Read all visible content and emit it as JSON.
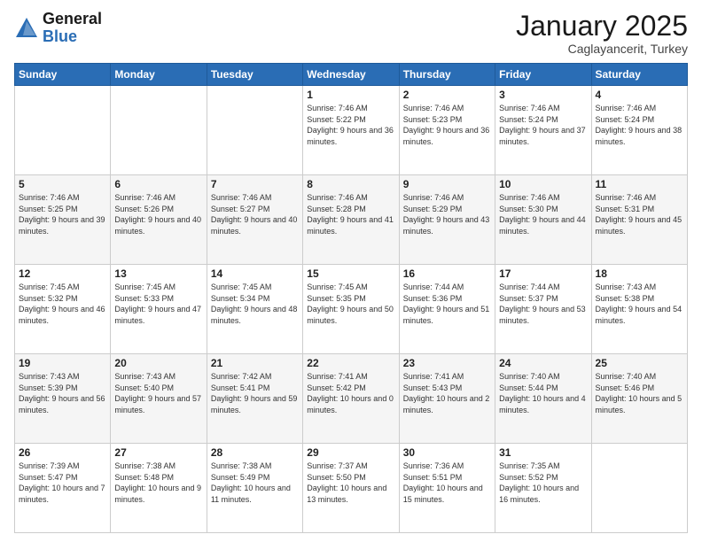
{
  "logo": {
    "general": "General",
    "blue": "Blue"
  },
  "header": {
    "month": "January 2025",
    "location": "Caglayancerit, Turkey"
  },
  "weekdays": [
    "Sunday",
    "Monday",
    "Tuesday",
    "Wednesday",
    "Thursday",
    "Friday",
    "Saturday"
  ],
  "weeks": [
    [
      null,
      null,
      null,
      {
        "day": "1",
        "sunrise": "Sunrise: 7:46 AM",
        "sunset": "Sunset: 5:22 PM",
        "daylight": "Daylight: 9 hours and 36 minutes."
      },
      {
        "day": "2",
        "sunrise": "Sunrise: 7:46 AM",
        "sunset": "Sunset: 5:23 PM",
        "daylight": "Daylight: 9 hours and 36 minutes."
      },
      {
        "day": "3",
        "sunrise": "Sunrise: 7:46 AM",
        "sunset": "Sunset: 5:24 PM",
        "daylight": "Daylight: 9 hours and 37 minutes."
      },
      {
        "day": "4",
        "sunrise": "Sunrise: 7:46 AM",
        "sunset": "Sunset: 5:24 PM",
        "daylight": "Daylight: 9 hours and 38 minutes."
      }
    ],
    [
      {
        "day": "5",
        "sunrise": "Sunrise: 7:46 AM",
        "sunset": "Sunset: 5:25 PM",
        "daylight": "Daylight: 9 hours and 39 minutes."
      },
      {
        "day": "6",
        "sunrise": "Sunrise: 7:46 AM",
        "sunset": "Sunset: 5:26 PM",
        "daylight": "Daylight: 9 hours and 40 minutes."
      },
      {
        "day": "7",
        "sunrise": "Sunrise: 7:46 AM",
        "sunset": "Sunset: 5:27 PM",
        "daylight": "Daylight: 9 hours and 40 minutes."
      },
      {
        "day": "8",
        "sunrise": "Sunrise: 7:46 AM",
        "sunset": "Sunset: 5:28 PM",
        "daylight": "Daylight: 9 hours and 41 minutes."
      },
      {
        "day": "9",
        "sunrise": "Sunrise: 7:46 AM",
        "sunset": "Sunset: 5:29 PM",
        "daylight": "Daylight: 9 hours and 43 minutes."
      },
      {
        "day": "10",
        "sunrise": "Sunrise: 7:46 AM",
        "sunset": "Sunset: 5:30 PM",
        "daylight": "Daylight: 9 hours and 44 minutes."
      },
      {
        "day": "11",
        "sunrise": "Sunrise: 7:46 AM",
        "sunset": "Sunset: 5:31 PM",
        "daylight": "Daylight: 9 hours and 45 minutes."
      }
    ],
    [
      {
        "day": "12",
        "sunrise": "Sunrise: 7:45 AM",
        "sunset": "Sunset: 5:32 PM",
        "daylight": "Daylight: 9 hours and 46 minutes."
      },
      {
        "day": "13",
        "sunrise": "Sunrise: 7:45 AM",
        "sunset": "Sunset: 5:33 PM",
        "daylight": "Daylight: 9 hours and 47 minutes."
      },
      {
        "day": "14",
        "sunrise": "Sunrise: 7:45 AM",
        "sunset": "Sunset: 5:34 PM",
        "daylight": "Daylight: 9 hours and 48 minutes."
      },
      {
        "day": "15",
        "sunrise": "Sunrise: 7:45 AM",
        "sunset": "Sunset: 5:35 PM",
        "daylight": "Daylight: 9 hours and 50 minutes."
      },
      {
        "day": "16",
        "sunrise": "Sunrise: 7:44 AM",
        "sunset": "Sunset: 5:36 PM",
        "daylight": "Daylight: 9 hours and 51 minutes."
      },
      {
        "day": "17",
        "sunrise": "Sunrise: 7:44 AM",
        "sunset": "Sunset: 5:37 PM",
        "daylight": "Daylight: 9 hours and 53 minutes."
      },
      {
        "day": "18",
        "sunrise": "Sunrise: 7:43 AM",
        "sunset": "Sunset: 5:38 PM",
        "daylight": "Daylight: 9 hours and 54 minutes."
      }
    ],
    [
      {
        "day": "19",
        "sunrise": "Sunrise: 7:43 AM",
        "sunset": "Sunset: 5:39 PM",
        "daylight": "Daylight: 9 hours and 56 minutes."
      },
      {
        "day": "20",
        "sunrise": "Sunrise: 7:43 AM",
        "sunset": "Sunset: 5:40 PM",
        "daylight": "Daylight: 9 hours and 57 minutes."
      },
      {
        "day": "21",
        "sunrise": "Sunrise: 7:42 AM",
        "sunset": "Sunset: 5:41 PM",
        "daylight": "Daylight: 9 hours and 59 minutes."
      },
      {
        "day": "22",
        "sunrise": "Sunrise: 7:41 AM",
        "sunset": "Sunset: 5:42 PM",
        "daylight": "Daylight: 10 hours and 0 minutes."
      },
      {
        "day": "23",
        "sunrise": "Sunrise: 7:41 AM",
        "sunset": "Sunset: 5:43 PM",
        "daylight": "Daylight: 10 hours and 2 minutes."
      },
      {
        "day": "24",
        "sunrise": "Sunrise: 7:40 AM",
        "sunset": "Sunset: 5:44 PM",
        "daylight": "Daylight: 10 hours and 4 minutes."
      },
      {
        "day": "25",
        "sunrise": "Sunrise: 7:40 AM",
        "sunset": "Sunset: 5:46 PM",
        "daylight": "Daylight: 10 hours and 5 minutes."
      }
    ],
    [
      {
        "day": "26",
        "sunrise": "Sunrise: 7:39 AM",
        "sunset": "Sunset: 5:47 PM",
        "daylight": "Daylight: 10 hours and 7 minutes."
      },
      {
        "day": "27",
        "sunrise": "Sunrise: 7:38 AM",
        "sunset": "Sunset: 5:48 PM",
        "daylight": "Daylight: 10 hours and 9 minutes."
      },
      {
        "day": "28",
        "sunrise": "Sunrise: 7:38 AM",
        "sunset": "Sunset: 5:49 PM",
        "daylight": "Daylight: 10 hours and 11 minutes."
      },
      {
        "day": "29",
        "sunrise": "Sunrise: 7:37 AM",
        "sunset": "Sunset: 5:50 PM",
        "daylight": "Daylight: 10 hours and 13 minutes."
      },
      {
        "day": "30",
        "sunrise": "Sunrise: 7:36 AM",
        "sunset": "Sunset: 5:51 PM",
        "daylight": "Daylight: 10 hours and 15 minutes."
      },
      {
        "day": "31",
        "sunrise": "Sunrise: 7:35 AM",
        "sunset": "Sunset: 5:52 PM",
        "daylight": "Daylight: 10 hours and 16 minutes."
      },
      null
    ]
  ]
}
